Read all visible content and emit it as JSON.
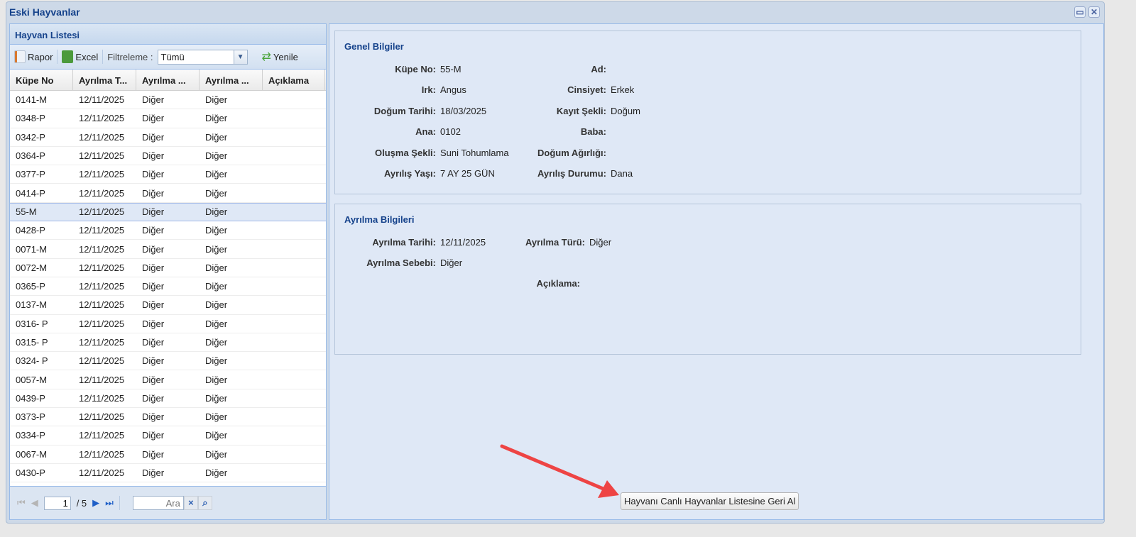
{
  "window": {
    "title": "Eski Hayvanlar",
    "maximize_icon": "maximize-icon",
    "close_icon": "close-icon"
  },
  "list": {
    "title": "Hayvan Listesi",
    "toolbar": {
      "rapor": "Rapor",
      "excel": "Excel",
      "filter_label": "Filtreleme :",
      "filter_value": "Tümü",
      "refresh": "Yenile"
    },
    "columns": [
      "Küpe No",
      "Ayrılma T...",
      "Ayrılma ...",
      "Ayrılma ...",
      "Açıklama"
    ],
    "rows": [
      [
        "0141-M",
        "12/11/2025",
        "Diğer",
        "Diğer",
        ""
      ],
      [
        "0348-P",
        "12/11/2025",
        "Diğer",
        "Diğer",
        ""
      ],
      [
        "0342-P",
        "12/11/2025",
        "Diğer",
        "Diğer",
        ""
      ],
      [
        "0364-P",
        "12/11/2025",
        "Diğer",
        "Diğer",
        ""
      ],
      [
        "0377-P",
        "12/11/2025",
        "Diğer",
        "Diğer",
        ""
      ],
      [
        "0414-P",
        "12/11/2025",
        "Diğer",
        "Diğer",
        ""
      ],
      [
        "55-M",
        "12/11/2025",
        "Diğer",
        "Diğer",
        ""
      ],
      [
        "0428-P",
        "12/11/2025",
        "Diğer",
        "Diğer",
        ""
      ],
      [
        "0071-M",
        "12/11/2025",
        "Diğer",
        "Diğer",
        ""
      ],
      [
        "0072-M",
        "12/11/2025",
        "Diğer",
        "Diğer",
        ""
      ],
      [
        "0365-P",
        "12/11/2025",
        "Diğer",
        "Diğer",
        ""
      ],
      [
        "0137-M",
        "12/11/2025",
        "Diğer",
        "Diğer",
        ""
      ],
      [
        "0316- P",
        "12/11/2025",
        "Diğer",
        "Diğer",
        ""
      ],
      [
        "0315- P",
        "12/11/2025",
        "Diğer",
        "Diğer",
        ""
      ],
      [
        "0324- P",
        "12/11/2025",
        "Diğer",
        "Diğer",
        ""
      ],
      [
        "0057-M",
        "12/11/2025",
        "Diğer",
        "Diğer",
        ""
      ],
      [
        "0439-P",
        "12/11/2025",
        "Diğer",
        "Diğer",
        ""
      ],
      [
        "0373-P",
        "12/11/2025",
        "Diğer",
        "Diğer",
        ""
      ],
      [
        "0334-P",
        "12/11/2025",
        "Diğer",
        "Diğer",
        ""
      ],
      [
        "0067-M",
        "12/11/2025",
        "Diğer",
        "Diğer",
        ""
      ],
      [
        "0430-P",
        "12/11/2025",
        "Diğer",
        "Diğer",
        ""
      ]
    ],
    "selected_index": 6,
    "pager": {
      "page": "1",
      "total": "/ 5",
      "search_placeholder": "Ara"
    }
  },
  "general": {
    "title": "Genel Bilgiler",
    "left": [
      [
        "Küpe No:",
        "55-M"
      ],
      [
        "Irk:",
        "Angus"
      ],
      [
        "Doğum Tarihi:",
        "18/03/2025"
      ],
      [
        "Ana:",
        "0102"
      ],
      [
        "Oluşma Şekli:",
        "Suni Tohumlama"
      ],
      [
        "Ayrılış Yaşı:",
        "7 AY 25 GÜN"
      ]
    ],
    "right": [
      [
        "Ad:",
        ""
      ],
      [
        "Cinsiyet:",
        "Erkek"
      ],
      [
        "Kayıt Şekli:",
        "Doğum"
      ],
      [
        "Baba:",
        ""
      ],
      [
        "Doğum Ağırlığı:",
        ""
      ],
      [
        "Ayrılış Durumu:",
        "Dana"
      ]
    ]
  },
  "departure": {
    "title": "Ayrılma Bilgileri",
    "date_label": "Ayrılma Tarihi:",
    "date": "12/11/2025",
    "type_label": "Ayrılma Türü:",
    "type": "Diğer",
    "reason_label": "Ayrılma Sebebi:",
    "reason": "Diğer",
    "note_label": "Açıklama:"
  },
  "action_button": "Hayvanı Canlı Hayvanlar Listesine Geri Al",
  "colors": {
    "accent": "#15428b",
    "arrow": "#ee4444"
  }
}
